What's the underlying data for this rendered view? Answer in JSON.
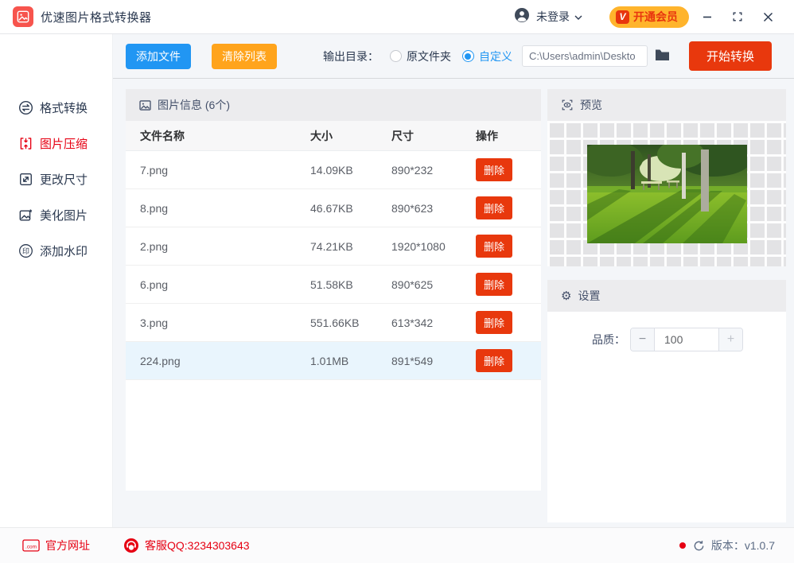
{
  "titlebar": {
    "app_title": "优速图片格式转换器",
    "login_label": "未登录",
    "vip_badge": "V",
    "vip_label": "开通会员"
  },
  "toolbar": {
    "add_files": "添加文件",
    "clear_list": "清除列表",
    "output_dir_label": "输出目录：",
    "radio_original": "原文件夹",
    "radio_custom": "自定义",
    "path_value": "C:\\Users\\admin\\Deskto",
    "start_convert": "开始转换"
  },
  "sidebar": {
    "items": [
      {
        "key": "format-convert",
        "label": "格式转换",
        "icon": "convert-icon",
        "active": false
      },
      {
        "key": "image-compress",
        "label": "图片压缩",
        "icon": "compress-icon",
        "active": true
      },
      {
        "key": "resize",
        "label": "更改尺寸",
        "icon": "resize-icon",
        "active": false
      },
      {
        "key": "beautify",
        "label": "美化图片",
        "icon": "beautify-icon",
        "active": false
      },
      {
        "key": "watermark",
        "label": "添加水印",
        "icon": "watermark-icon",
        "active": false
      }
    ]
  },
  "table": {
    "title": "图片信息 (6个)",
    "columns": {
      "name": "文件名称",
      "size": "大小",
      "dims": "尺寸",
      "action": "操作"
    },
    "delete_label": "删除",
    "rows": [
      {
        "name": "7.png",
        "size": "14.09KB",
        "dims": "890*232",
        "selected": false
      },
      {
        "name": "8.png",
        "size": "46.67KB",
        "dims": "890*623",
        "selected": false
      },
      {
        "name": "2.png",
        "size": "74.21KB",
        "dims": "1920*1080",
        "selected": false
      },
      {
        "name": "6.png",
        "size": "51.58KB",
        "dims": "890*625",
        "selected": false
      },
      {
        "name": "3.png",
        "size": "551.66KB",
        "dims": "613*342",
        "selected": false
      },
      {
        "name": "224.png",
        "size": "1.01MB",
        "dims": "891*549",
        "selected": true
      }
    ]
  },
  "preview": {
    "title": "预览"
  },
  "settings": {
    "title": "设置",
    "gear_glyph": "⚙",
    "quality_label": "品质：",
    "quality_value": "100",
    "minus_glyph": "−",
    "plus_glyph": "+"
  },
  "footer": {
    "website": "官方网址",
    "qq": "客服QQ:3234303643",
    "version": "版本：v1.0.7"
  },
  "colors": {
    "accent_blue": "#2196f3",
    "accent_orange": "#ffa41c",
    "accent_red_button": "#e8380d",
    "vip_pill": "#ffb42c",
    "sidebar_active": "#e60012",
    "selected_row": "#e9f5fd",
    "footer_red": "#e60012"
  }
}
